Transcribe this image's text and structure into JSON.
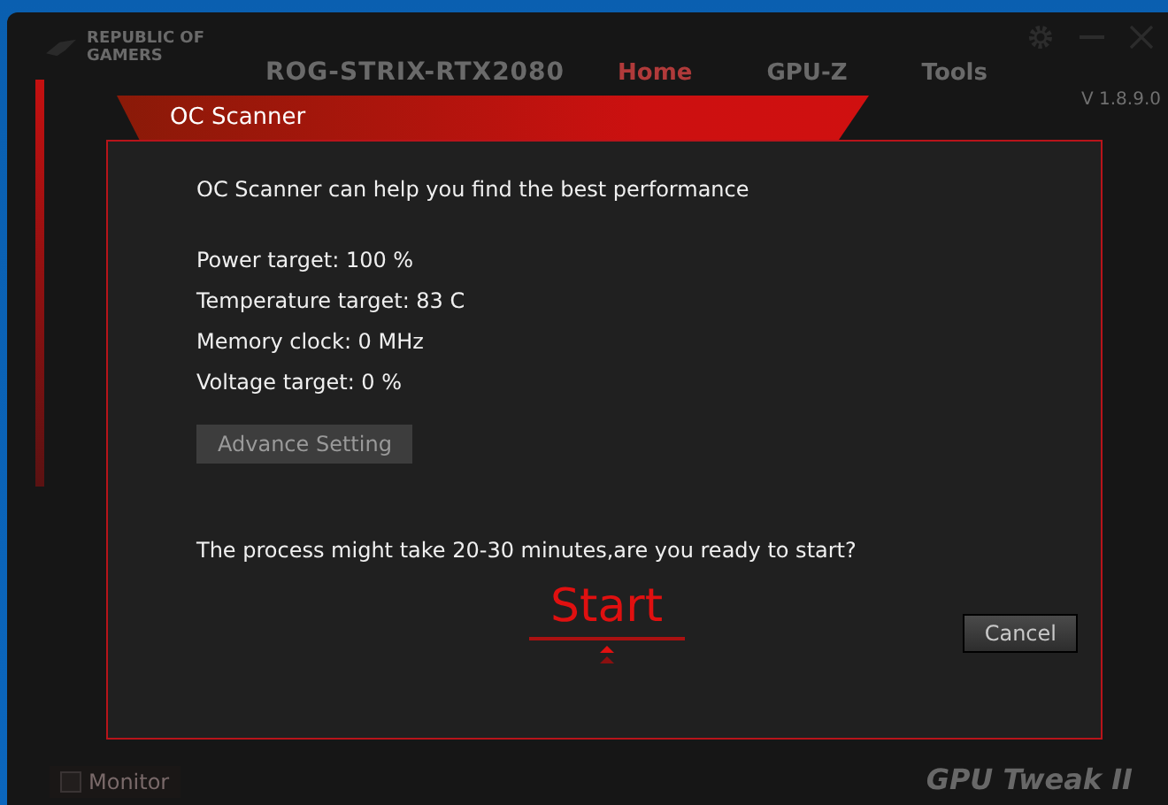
{
  "app": {
    "brand": "REPUBLIC OF GAMERS",
    "device": "ROG-STRIX-RTX2080",
    "nav": [
      {
        "label": "Home",
        "selected": true
      },
      {
        "label": "GPU-Z",
        "selected": false
      },
      {
        "label": "Tools",
        "selected": false
      }
    ],
    "version": "V 1.8.9.0",
    "monitor": "Monitor",
    "product": "GPU Tweak II"
  },
  "dialog": {
    "title": "OC Scanner",
    "intro": "OC Scanner can help you find the best performance",
    "settings": [
      "Power target: 100 %",
      "Temperature target: 83 C",
      "Memory clock: 0 MHz",
      "Voltage target: 0 %"
    ],
    "advance_button": "Advance Setting",
    "prompt": "The process might take 20-30 minutes,are you ready to start?",
    "start_button": "Start",
    "cancel_button": "Cancel"
  }
}
